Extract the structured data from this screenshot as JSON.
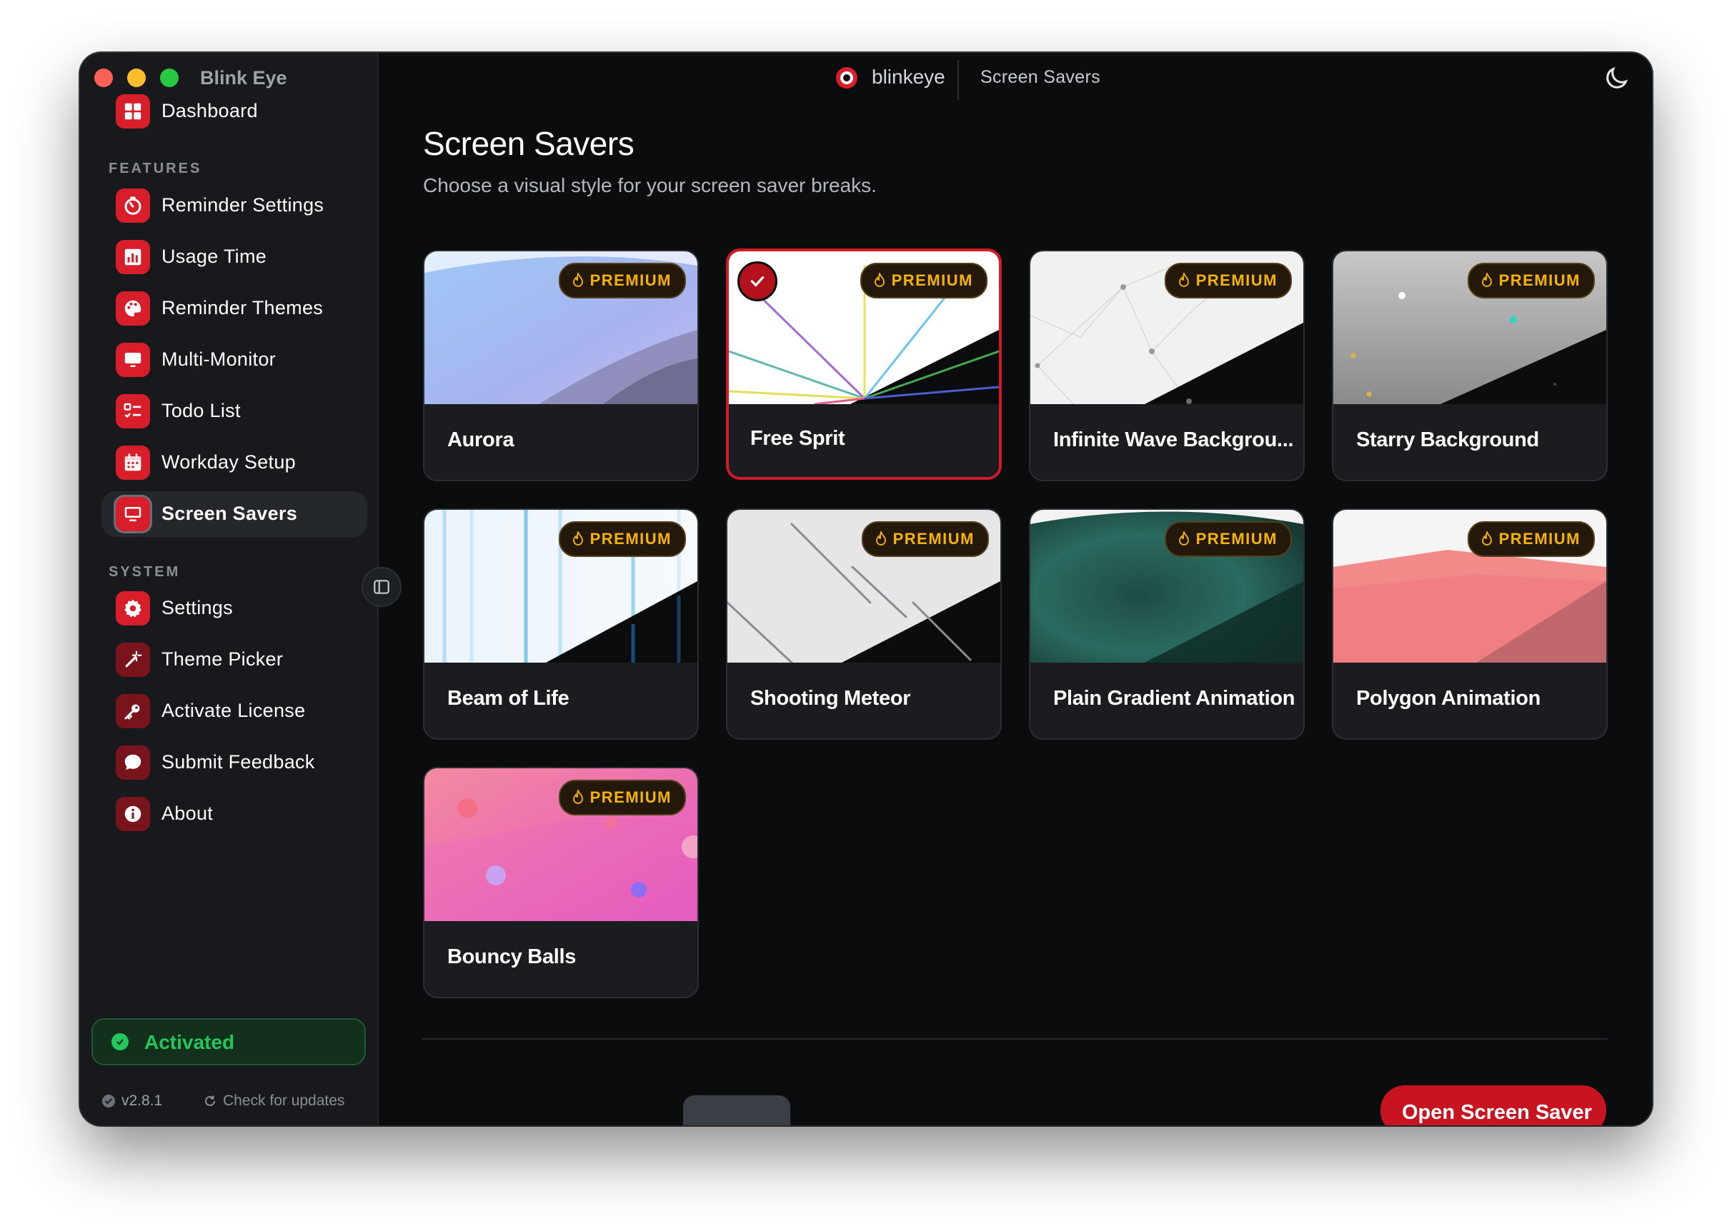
{
  "window": {
    "title": "Blink Eye"
  },
  "topbar": {
    "brand": "blinkeye",
    "breadcrumb": "Screen Savers"
  },
  "sidebar": {
    "top_item": {
      "label": "Dashboard",
      "icon": "dashboard-icon"
    },
    "features_label": "FEATURES",
    "features": [
      {
        "label": "Reminder Settings",
        "icon": "timer-icon"
      },
      {
        "label": "Usage Time",
        "icon": "bar-chart-icon"
      },
      {
        "label": "Reminder Themes",
        "icon": "palette-icon"
      },
      {
        "label": "Multi-Monitor",
        "icon": "monitor-icon"
      },
      {
        "label": "Todo List",
        "icon": "checklist-icon"
      },
      {
        "label": "Workday Setup",
        "icon": "calendar-icon"
      },
      {
        "label": "Screen Savers",
        "icon": "screen-icon",
        "active": true
      }
    ],
    "system_label": "SYSTEM",
    "system": [
      {
        "label": "Settings",
        "icon": "gear-icon"
      },
      {
        "label": "Theme Picker",
        "icon": "magic-wand-icon"
      },
      {
        "label": "Activate License",
        "icon": "key-icon"
      },
      {
        "label": "Submit Feedback",
        "icon": "chat-bubble-icon"
      },
      {
        "label": "About",
        "icon": "info-icon"
      }
    ],
    "status": {
      "label": "Activated",
      "color": "#22c55e"
    },
    "version": "v2.8.1",
    "updates_label": "Check for updates"
  },
  "main": {
    "title": "Screen Savers",
    "subtitle": "Choose a visual style for your screen saver breaks.",
    "premium_label": "PREMIUM",
    "cards": [
      {
        "name": "Aurora",
        "premium": true,
        "selected": false
      },
      {
        "name": "Free Sprit",
        "premium": true,
        "selected": true
      },
      {
        "name": "Infinite Wave Backgrou...",
        "premium": true,
        "selected": false
      },
      {
        "name": "Starry Background",
        "premium": true,
        "selected": false
      },
      {
        "name": "Beam of Life",
        "premium": true,
        "selected": false
      },
      {
        "name": "Shooting Meteor",
        "premium": true,
        "selected": false
      },
      {
        "name": "Plain Gradient Animation",
        "premium": true,
        "selected": false
      },
      {
        "name": "Polygon Animation",
        "premium": true,
        "selected": false
      },
      {
        "name": "Bouncy Balls",
        "premium": true,
        "selected": false
      }
    ],
    "open_button": "Open Screen Saver"
  },
  "colors": {
    "accent": "#d81e2a",
    "premium": "#f5b400",
    "background": "#0b0c0e",
    "sidebar": "#17191c"
  }
}
